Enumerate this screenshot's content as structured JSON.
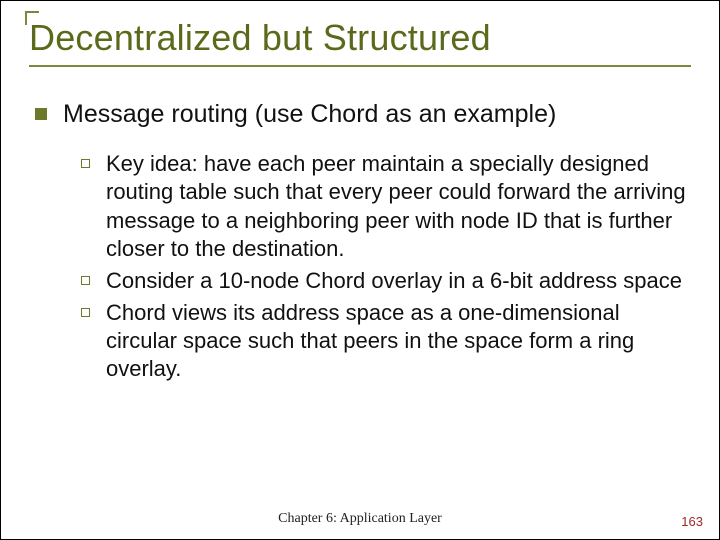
{
  "title": "Decentralized but Structured",
  "l1": {
    "text": "Message routing (use Chord as an example)"
  },
  "l2": [
    {
      "text": "Key idea: have each peer maintain a specially designed routing table such that every peer could forward the arriving message to a neighboring peer with node ID that is further closer to the destination."
    },
    {
      "text": "Consider a 10-node Chord overlay in a 6-bit address space"
    },
    {
      "text": "Chord views its address space as a one-dimensional circular space such that peers in the space form a ring overlay."
    }
  ],
  "footer": "Chapter 6: Application Layer",
  "page": "163"
}
